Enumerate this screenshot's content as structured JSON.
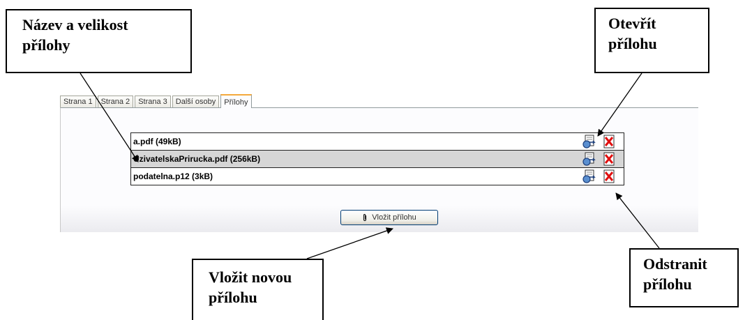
{
  "tabs": [
    "Strana 1",
    "Strana 2",
    "Strana 3",
    "Další osoby",
    "Přílohy"
  ],
  "active_tab": "Přílohy",
  "attachments": [
    {
      "name": "a.pdf  (49kB)",
      "selected": false
    },
    {
      "name": "UzivatelskaPrirucka.pdf  (256kB)",
      "selected": true
    },
    {
      "name": "podatelna.p12  (3kB)",
      "selected": false
    }
  ],
  "add_button": {
    "label": "Vložit přílohu",
    "icon": "paperclip-icon"
  },
  "row_icons": {
    "open": "open-attachment-icon",
    "remove": "delete-attachment-icon"
  },
  "callouts": {
    "name_size": {
      "line1": "Název a velikost",
      "line2": "přílohy"
    },
    "open": {
      "line1": "Otevřít",
      "line2": "přílohu"
    },
    "remove": {
      "line1": "Odstranit",
      "line2": "přílohu"
    },
    "insert": {
      "line1": "Vložit novou",
      "line2": "přílohu"
    }
  },
  "colors": {
    "active_tab_accent": "#f4a93b",
    "selected_row": "#d6d6d6",
    "button_border": "#003c74"
  }
}
